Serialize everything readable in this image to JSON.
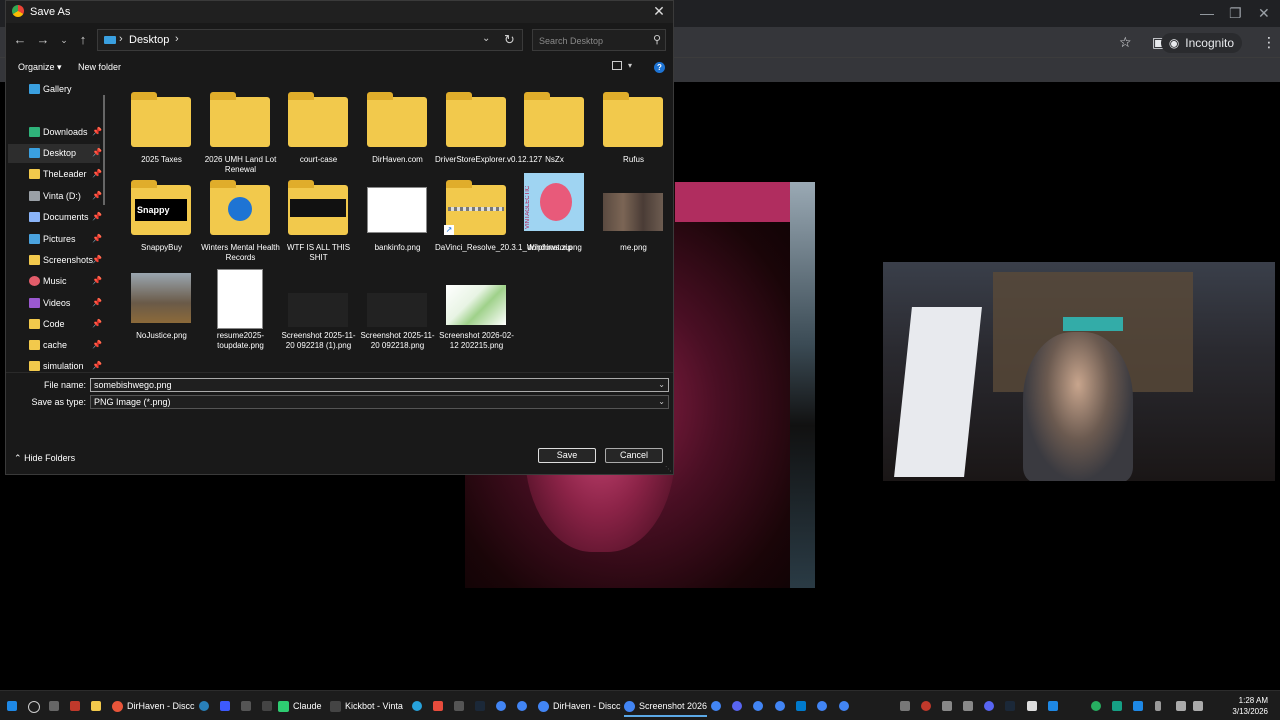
{
  "browser": {
    "incognito_label": "Incognito"
  },
  "dialog": {
    "title": "Save As",
    "address": {
      "location": "Desktop"
    },
    "search": {
      "placeholder": "Search Desktop"
    },
    "commands": {
      "organize": "Organize",
      "new_folder": "New folder"
    },
    "sidebar": {
      "items": [
        {
          "label": "Gallery",
          "color": "#3aa0e0",
          "pinned": false
        },
        {
          "label": "Downloads",
          "color": "#2fb37a",
          "pinned": true
        },
        {
          "label": "Desktop",
          "color": "#3aa0e0",
          "pinned": true,
          "active": true
        },
        {
          "label": "TheLeader",
          "color": "#f2c94c",
          "pinned": true
        },
        {
          "label": "Vinta (D:)",
          "color": "#9aa0a6",
          "pinned": true
        },
        {
          "label": "Documents",
          "color": "#8ab4f8",
          "pinned": true
        },
        {
          "label": "Pictures",
          "color": "#4aa3df",
          "pinned": true
        },
        {
          "label": "Screenshots",
          "color": "#f2c94c",
          "pinned": true
        },
        {
          "label": "Music",
          "color": "#e35d6a",
          "pinned": true
        },
        {
          "label": "Videos",
          "color": "#9b59d0",
          "pinned": true
        },
        {
          "label": "Code",
          "color": "#f2c94c",
          "pinned": true
        },
        {
          "label": "cache",
          "color": "#f2c94c",
          "pinned": true
        },
        {
          "label": "simulation",
          "color": "#f2c94c",
          "pinned": true
        }
      ]
    },
    "files": [
      {
        "name": "2025 Taxes",
        "kind": "folder"
      },
      {
        "name": "2026 UMH Land Lot Renewal",
        "kind": "folder"
      },
      {
        "name": "court-case",
        "kind": "folder"
      },
      {
        "name": "DirHaven.com",
        "kind": "folder"
      },
      {
        "name": "DriverStoreExplorer.v0.12.127",
        "kind": "folder"
      },
      {
        "name": "NsZx",
        "kind": "folder"
      },
      {
        "name": "Rufus",
        "kind": "folder"
      },
      {
        "name": "SnappyBuy",
        "kind": "folder",
        "thumb_text": "Snappy"
      },
      {
        "name": "Winters Mental Health Records",
        "kind": "folder"
      },
      {
        "name": "WTF IS ALL THIS SHIT",
        "kind": "folder"
      },
      {
        "name": "bankinfo.png",
        "kind": "image"
      },
      {
        "name": "DaVinci_Resolve_20.3.1_Windows.zip",
        "kind": "zip"
      },
      {
        "name": "dolphinator.png",
        "kind": "image",
        "thumb_text": "VINTAGLECTIC"
      },
      {
        "name": "me.png",
        "kind": "image"
      },
      {
        "name": "NoJustice.png",
        "kind": "image"
      },
      {
        "name": "resume2025-toupdate.png",
        "kind": "image"
      },
      {
        "name": "Screenshot 2025-11-20 092218 (1).png",
        "kind": "image"
      },
      {
        "name": "Screenshot 2025-11-20 092218.png",
        "kind": "image"
      },
      {
        "name": "Screenshot 2026-02-12 202215.png",
        "kind": "image"
      }
    ],
    "filename": {
      "label": "File name:",
      "value": "somebishwego.png"
    },
    "filetype": {
      "label": "Save as type:",
      "value": "PNG Image (*.png)"
    },
    "hide_folders": "Hide Folders",
    "save_label": "Save",
    "cancel_label": "Cancel"
  },
  "taskbar": {
    "apps": [
      {
        "label": "DirHaven - Discc"
      },
      {
        "label": "Claude"
      },
      {
        "label": "Kickbot - Vinta"
      },
      {
        "label": "DirHaven - Discc"
      },
      {
        "label": "Screenshot 2026"
      }
    ],
    "time": "1:28 AM",
    "date": "3/13/2026"
  }
}
